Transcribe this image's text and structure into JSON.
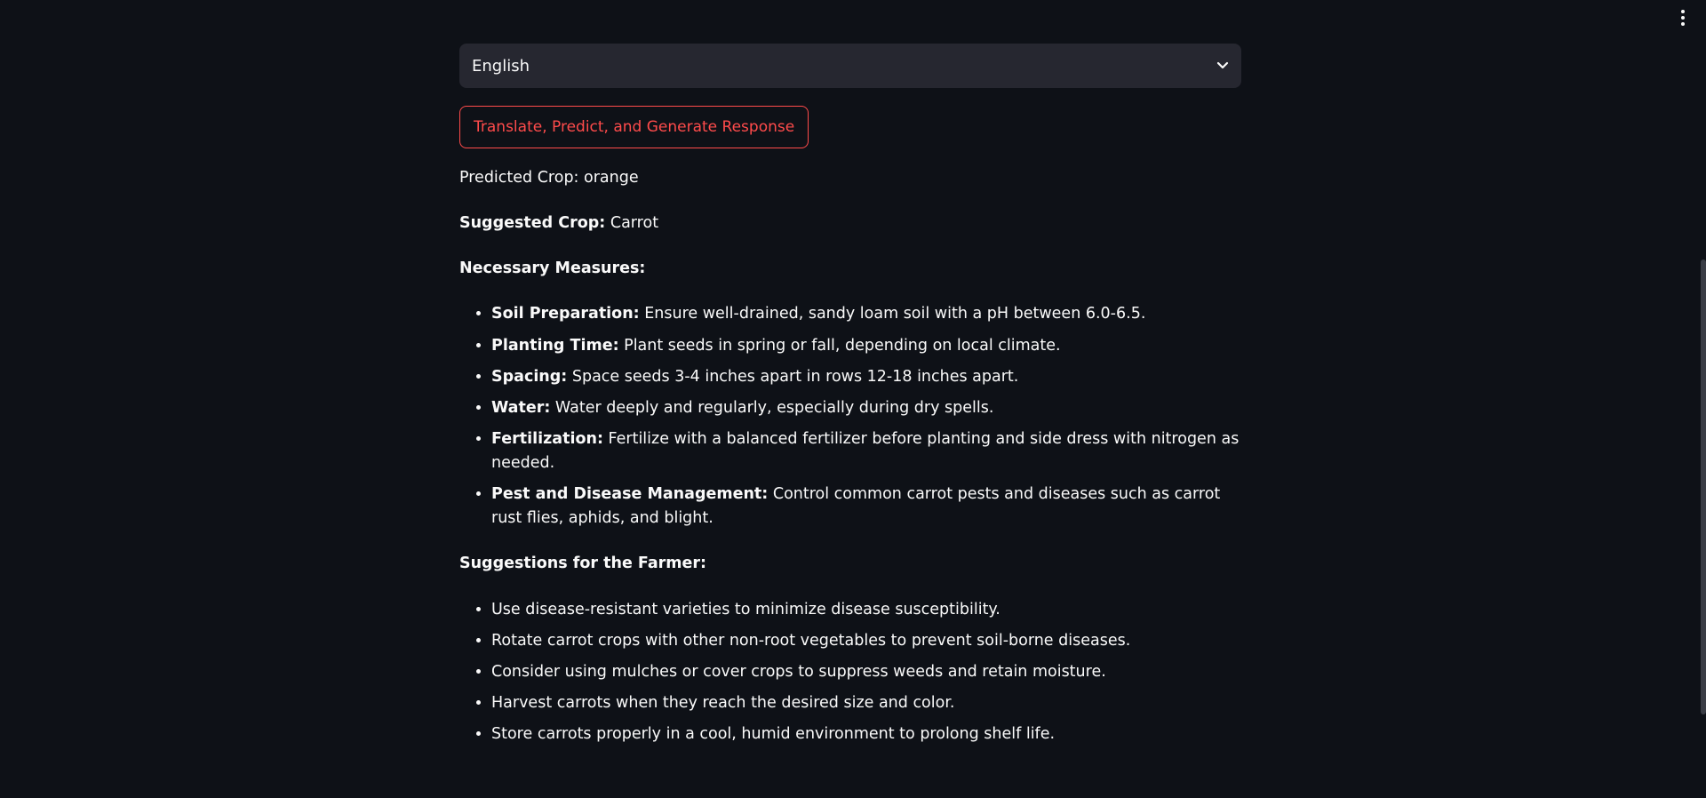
{
  "language_select": {
    "value": "English"
  },
  "action_button": {
    "label": "Translate, Predict, and Generate Response"
  },
  "result": {
    "predicted_label": "Predicted Crop: orange",
    "suggested_label": "Suggested Crop:",
    "suggested_value": " Carrot",
    "measures_heading": "Necessary Measures:",
    "measures": [
      {
        "term": "Soil Preparation:",
        "text": " Ensure well-drained, sandy loam soil with a pH between 6.0-6.5."
      },
      {
        "term": "Planting Time:",
        "text": " Plant seeds in spring or fall, depending on local climate."
      },
      {
        "term": "Spacing:",
        "text": " Space seeds 3-4 inches apart in rows 12-18 inches apart."
      },
      {
        "term": "Water:",
        "text": " Water deeply and regularly, especially during dry spells."
      },
      {
        "term": "Fertilization:",
        "text": " Fertilize with a balanced fertilizer before planting and side dress with nitrogen as needed."
      },
      {
        "term": "Pest and Disease Management:",
        "text": " Control common carrot pests and diseases such as carrot rust flies, aphids, and blight."
      }
    ],
    "suggestions_heading": "Suggestions for the Farmer:",
    "suggestions": [
      "Use disease-resistant varieties to minimize disease susceptibility.",
      "Rotate carrot crops with other non-root vegetables to prevent soil-borne diseases.",
      "Consider using mulches or cover crops to suppress weeds and retain moisture.",
      "Harvest carrots when they reach the desired size and color.",
      "Store carrots properly in a cool, humid environment to prolong shelf life."
    ]
  },
  "icons": {
    "menu": "vertical-ellipsis-icon",
    "dropdown": "chevron-down-icon"
  },
  "colors": {
    "background": "#0e1117",
    "select_bg": "#262730",
    "accent": "#ff4b4b",
    "text": "#fafafa"
  }
}
